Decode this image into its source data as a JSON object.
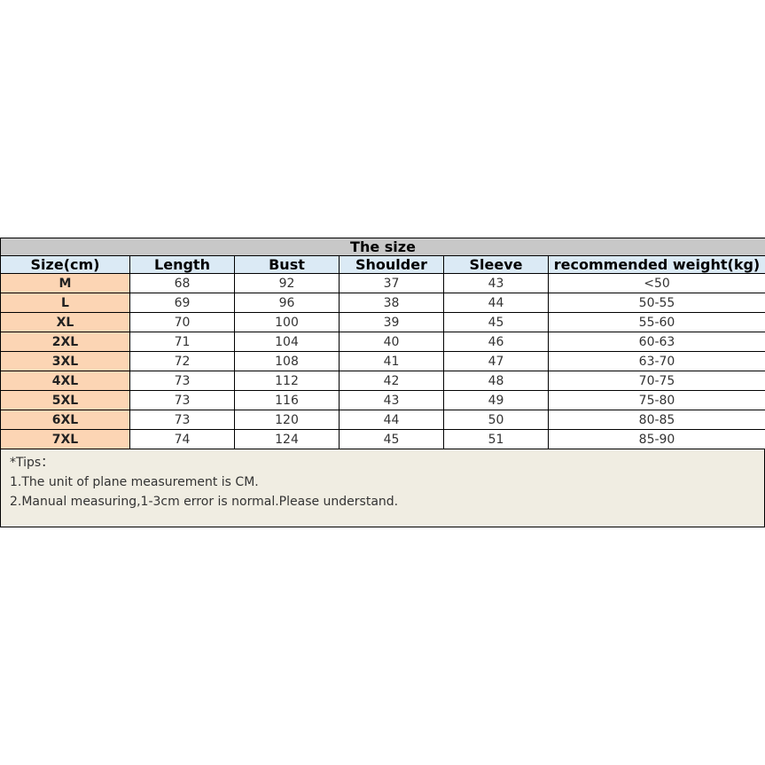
{
  "table": {
    "title": "The size",
    "headers": [
      "Size(cm)",
      "Length",
      "Bust",
      "Shoulder",
      "Sleeve",
      "recommended weight(kg)"
    ],
    "rows": [
      [
        "M",
        "68",
        "92",
        "37",
        "43",
        "<50"
      ],
      [
        "L",
        "69",
        "96",
        "38",
        "44",
        "50-55"
      ],
      [
        "XL",
        "70",
        "100",
        "39",
        "45",
        "55-60"
      ],
      [
        "2XL",
        "71",
        "104",
        "40",
        "46",
        "60-63"
      ],
      [
        "3XL",
        "72",
        "108",
        "41",
        "47",
        "63-70"
      ],
      [
        "4XL",
        "73",
        "112",
        "42",
        "48",
        "70-75"
      ],
      [
        "5XL",
        "73",
        "116",
        "43",
        "49",
        "75-80"
      ],
      [
        "6XL",
        "73",
        "120",
        "44",
        "50",
        "80-85"
      ],
      [
        "7XL",
        "74",
        "124",
        "45",
        "51",
        "85-90"
      ]
    ]
  },
  "tips": {
    "label": "*Tips：",
    "lines": [
      "1.The unit of plane measurement is CM.",
      "2.Manual measuring,1-3cm error is normal.Please understand."
    ]
  },
  "colors": {
    "title_bg": "#c8c8c8",
    "header_bg": "#dbeaf5",
    "size_col_bg": "#fcd5b4",
    "tips_bg": "#f0ede2"
  }
}
